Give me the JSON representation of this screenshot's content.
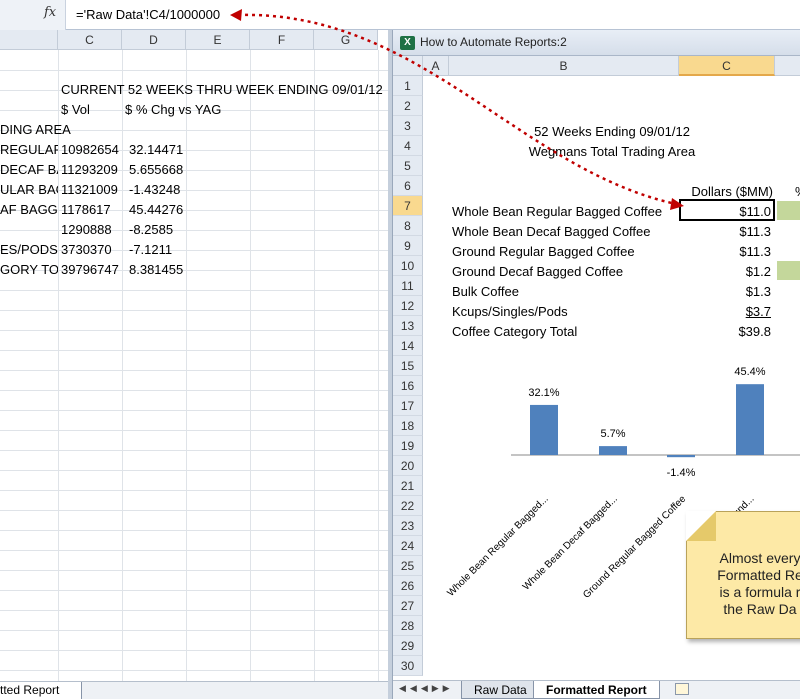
{
  "formula_bar": {
    "fx_label": "fx",
    "formula": "='Raw Data'!C4/1000000"
  },
  "left": {
    "columns": [
      "C",
      "D",
      "E",
      "F",
      "G"
    ],
    "row1_header": "CURRENT 52 WEEKS THRU WEEK ENDING 09/01/12",
    "row2_c": "$ Vol",
    "row2_d": "$ % Chg vs YAG",
    "row3_b": "DING AREA",
    "rows": [
      {
        "b": "REGULAF",
        "c": "10982654",
        "d": "32.14471"
      },
      {
        "b": "DECAF BA",
        "c": "11293209",
        "d": "5.655668"
      },
      {
        "b": "ULAR BAG",
        "c": "11321009",
        "d": "-1.43248"
      },
      {
        "b": "AF BAGGE",
        "c": "1178617",
        "d": "45.44276"
      },
      {
        "b": "",
        "c": "1290888",
        "d": "-8.2585"
      },
      {
        "b": "ES/PODS",
        "c": "3730370",
        "d": "-7.1211"
      },
      {
        "b": "GORY TOT",
        "c": "39796747",
        "d": "8.381455"
      }
    ],
    "tab_label": "tted Report"
  },
  "right": {
    "window_title": "How to Automate Reports:2",
    "columns": [
      "A",
      "B",
      "C"
    ],
    "row_numbers": [
      "1",
      "2",
      "3",
      "4",
      "5",
      "6",
      "7",
      "8",
      "9",
      "10",
      "11",
      "12",
      "13",
      "14",
      "15",
      "16",
      "17",
      "18",
      "19",
      "20",
      "21",
      "22",
      "23",
      "24",
      "25",
      "26",
      "27",
      "28",
      "29",
      "30"
    ],
    "title_line1": "52 Weeks Ending 09/01/12",
    "title_line2": "Wegmans Total Trading Area",
    "dollars_header": "Dollars ($MM)",
    "pct_header_fragment": "%",
    "table": [
      {
        "label": "Whole Bean Regular Bagged Coffee",
        "value": "$11.0"
      },
      {
        "label": "Whole Bean Decaf Bagged Coffee",
        "value": "$11.3"
      },
      {
        "label": "Ground Regular Bagged Coffee",
        "value": "$11.3"
      },
      {
        "label": "Ground Decaf Bagged Coffee",
        "value": "$1.2"
      },
      {
        "label": "Bulk Coffee",
        "value": "$1.3"
      },
      {
        "label": "Kcups/Singles/Pods",
        "value": "$3.7"
      },
      {
        "label": "Coffee Category Total",
        "value": "$39.8"
      }
    ],
    "tabs": [
      "Raw Data",
      "Formatted Report"
    ],
    "note_lines": [
      "Almost every",
      "Formatted Re",
      "is a formula r",
      "the Raw Da"
    ],
    "accent_green": "#c4d79b",
    "bar_color": "#4f81bd",
    "arrow_color": "#c00000"
  },
  "chart_data": {
    "type": "bar",
    "categories": [
      "Whole Bean Regular Bagged...",
      "Whole Bean Decaf Bagged...",
      "Ground Regular Bagged Coffee",
      "Ground..."
    ],
    "values": [
      32.1,
      5.7,
      -1.4,
      45.4
    ],
    "data_labels": [
      "32.1%",
      "5.7%",
      "-1.4%",
      "45.4%"
    ],
    "title": "",
    "xlabel": "",
    "ylabel": ""
  }
}
